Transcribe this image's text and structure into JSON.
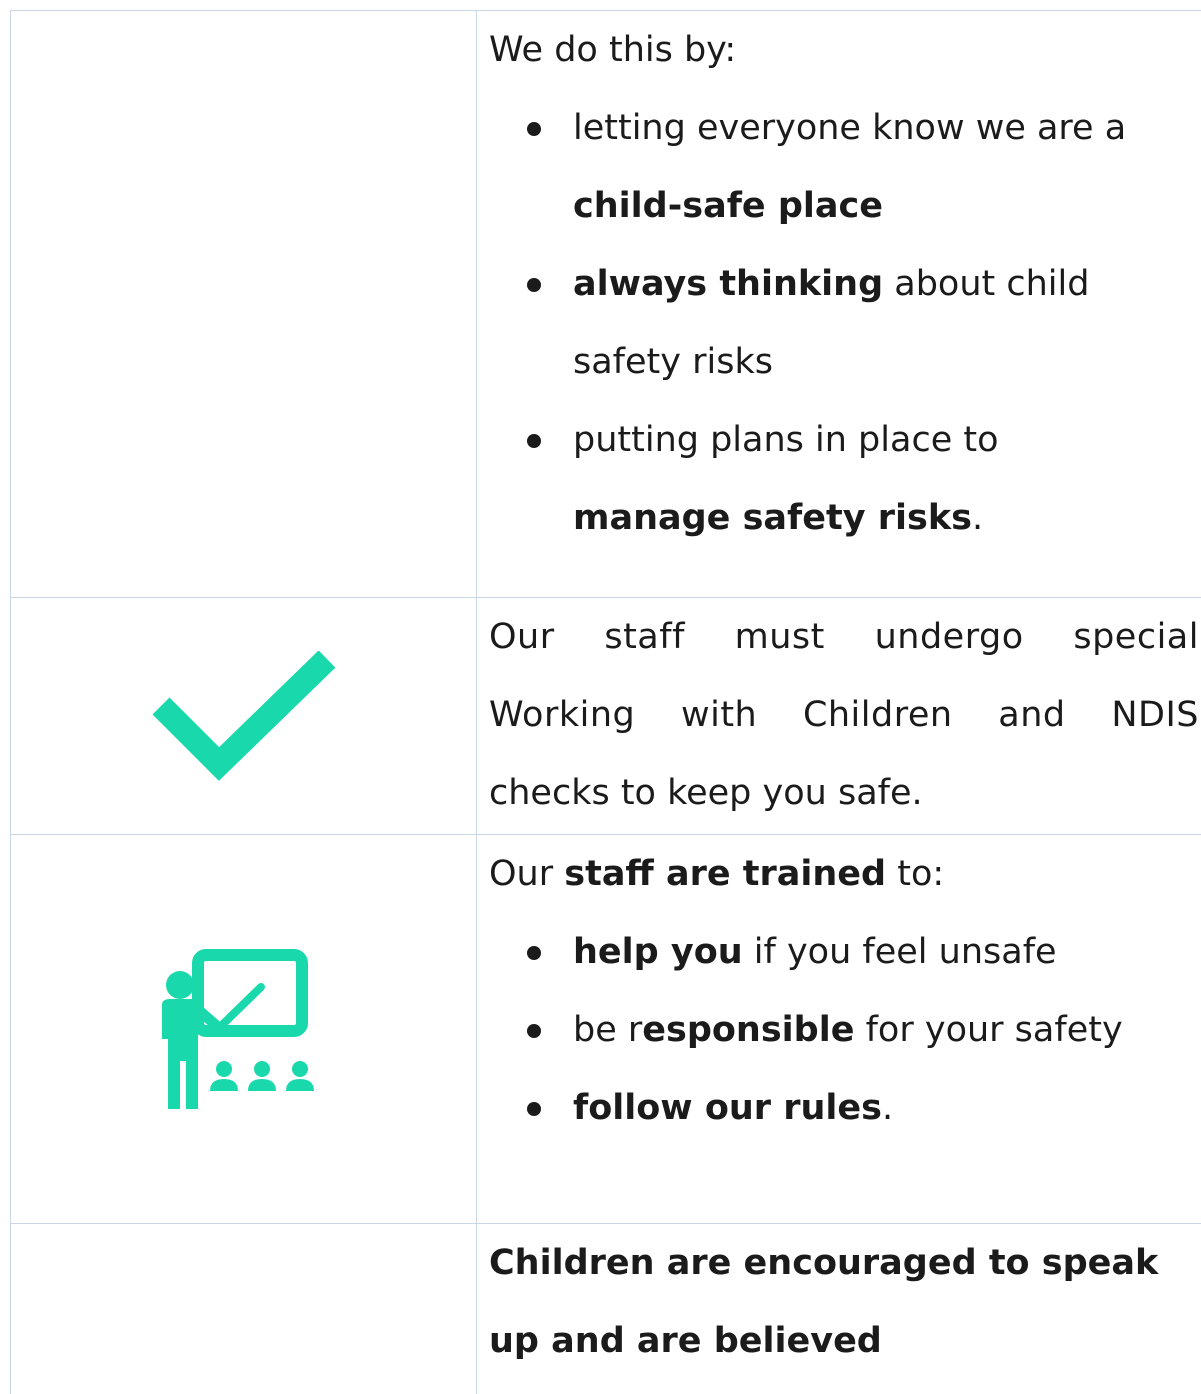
{
  "section1": {
    "intro": "We do this by:",
    "bullet1_line1": "letting everyone know we are a",
    "bullet1_line2": "child-safe place",
    "bullet2_bold": "always thinking",
    "bullet2_rest": " about child",
    "bullet2_line2": "safety risks",
    "bullet3_line1": "putting plans in place to",
    "bullet3_bold": "manage safety risks",
    "bullet3_end": "."
  },
  "section2": {
    "icon": "check-mark-icon",
    "line1_words": [
      "Our",
      "staff",
      "must",
      "undergo",
      "special"
    ],
    "line2_words": [
      "Working",
      "with",
      "Children",
      "and",
      "NDIS"
    ],
    "line3": "checks to keep you safe."
  },
  "section3": {
    "icon": "teacher-presentation-icon",
    "intro_pre": "Our ",
    "intro_bold": "staff are trained",
    "intro_post": " to:",
    "bullet1_bold": "help you",
    "bullet1_rest": " if you feel unsafe",
    "bullet2_pre": "be r",
    "bullet2_bold": "esponsible",
    "bullet2_rest": " for your safety",
    "bullet3_bold": "follow our rules",
    "bullet3_end": "."
  },
  "section4": {
    "line1": "Children are encouraged to speak",
    "line2": "up and are believed"
  },
  "colors": {
    "accent": "#19d9ac",
    "border": "#c9d6e6",
    "text": "#1b1b1b"
  }
}
